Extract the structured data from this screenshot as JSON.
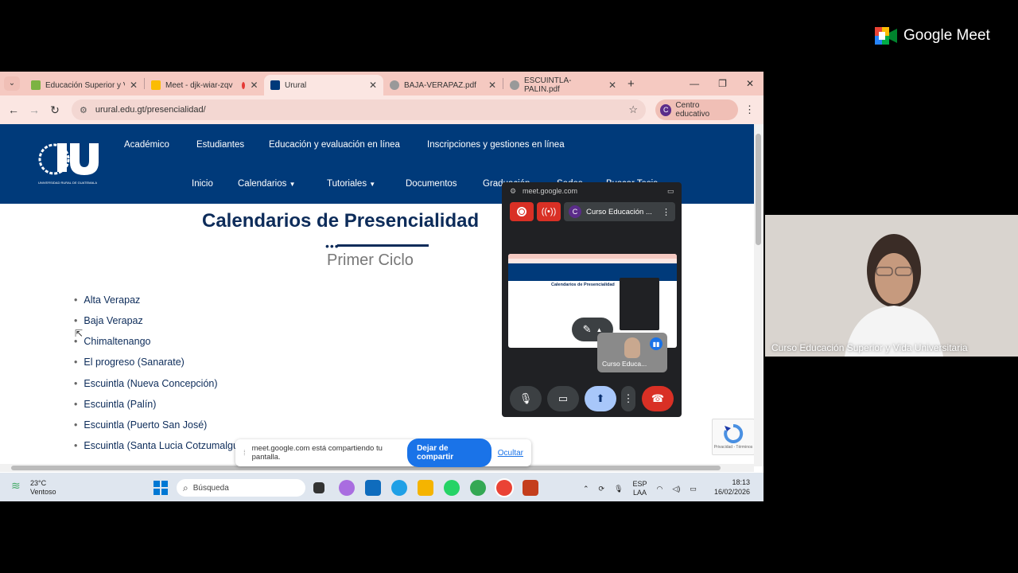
{
  "meet": {
    "brand": "Google Meet"
  },
  "browser": {
    "tabs": [
      {
        "label": "Educación Superior y Vid",
        "color": "#2e7d32"
      },
      {
        "label": "Meet - djk-wiar-zqv",
        "color": "#00897b"
      },
      {
        "label": "Urural",
        "color": "#003a7a"
      },
      {
        "label": "BAJA-VERAPAZ.pdf",
        "color": "#777777"
      },
      {
        "label": "ESCUINTLA-PALIN.pdf",
        "color": "#777777"
      }
    ],
    "new_tab": "+",
    "url": "urural.edu.gt/presencialidad/",
    "profile": {
      "initial": "C",
      "label": "Centro educativo"
    }
  },
  "site": {
    "logo_caption": "UNIVERSIDAD RURAL DE GUATEMALA",
    "top_nav": [
      "Académico",
      "Estudiantes",
      "Educación y evaluación en línea",
      "Inscripciones y gestiones en línea"
    ],
    "main_nav": [
      "Inicio",
      "Calendarios",
      "Tutoriales",
      "Documentos",
      "Graduación",
      "Sedes",
      "Buscar Tesis"
    ],
    "title": "Calendarios de Presencialidad",
    "subtitle": "Primer Ciclo",
    "departments": [
      "Alta Verapaz",
      "Baja Verapaz",
      "Chimaltenango",
      "El progreso (Sanarate)",
      "Escuintla (Nueva Concepción)",
      "Escuintla (Palín)",
      "Escuintla (Puerto San José)",
      "Escuintla (Santa Lucia Cotzumalguapa)"
    ]
  },
  "share_banner": {
    "text": "meet.google.com está compartiendo tu pantalla.",
    "stop": "Dejar de compartir",
    "hide": "Ocultar"
  },
  "recaptcha": {
    "text": "Privacidad - Términos"
  },
  "taskbar": {
    "weather_temp": "23°C",
    "weather_desc": "Ventoso",
    "search_placeholder": "Búsqueda",
    "lang_1": "ESP",
    "lang_2": "LAA",
    "time": "18:13",
    "date": "16/02/2026"
  },
  "pip": {
    "url": "meet.google.com",
    "meeting_chip": {
      "initial": "C",
      "label": "Curso Educación ..."
    },
    "self_label": "Curso Educa..."
  },
  "participant": {
    "name": "Curso Educación Superior y Vida Universitaria"
  }
}
